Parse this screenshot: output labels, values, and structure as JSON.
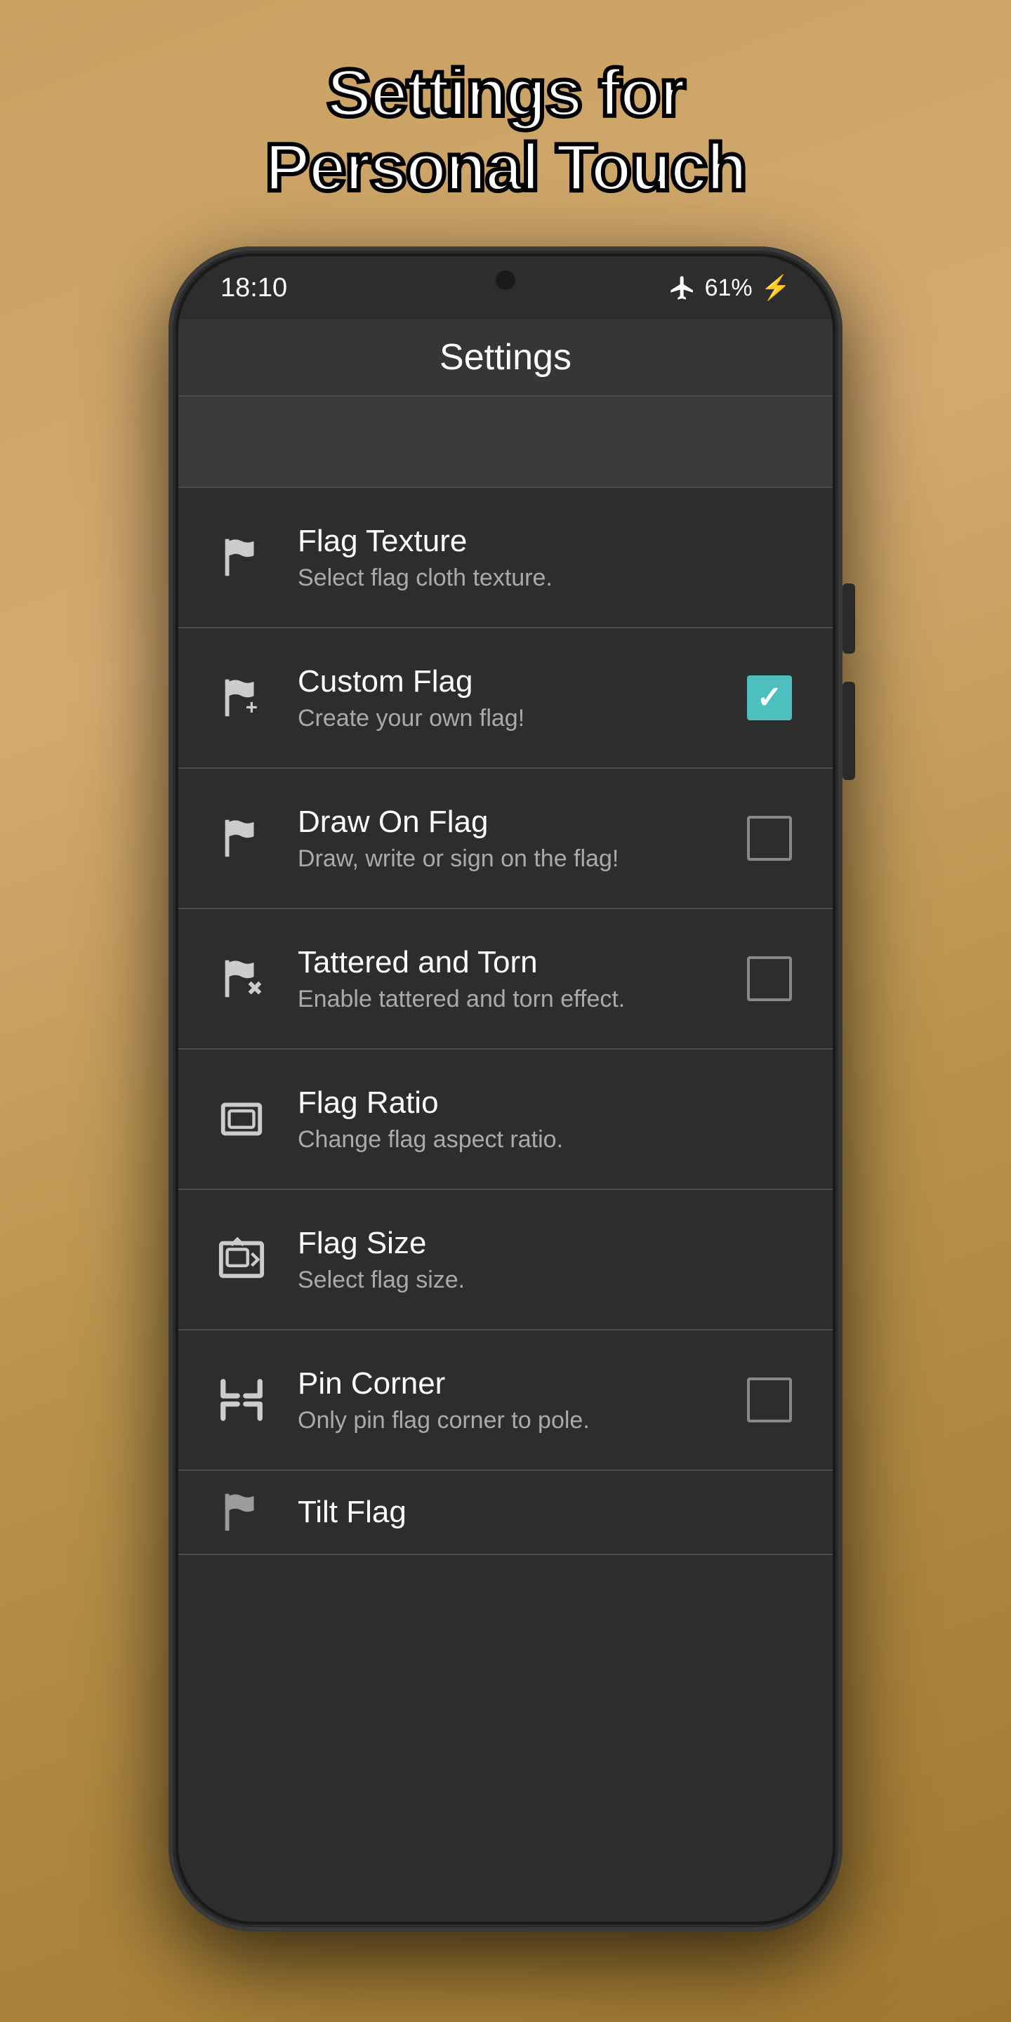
{
  "page": {
    "title_line1": "Settings for",
    "title_line2": "Personal Touch"
  },
  "status_bar": {
    "time": "18:10",
    "battery_text": "61%",
    "battery_icon": "⚡"
  },
  "app_header": {
    "title": "Settings"
  },
  "settings": {
    "items": [
      {
        "id": "flag-texture",
        "title": "Flag Texture",
        "subtitle": "Select flag cloth texture.",
        "has_checkbox": false,
        "checked": false,
        "icon": "flag-texture-icon"
      },
      {
        "id": "custom-flag",
        "title": "Custom Flag",
        "subtitle": "Create your own flag!",
        "has_checkbox": true,
        "checked": true,
        "icon": "custom-flag-icon"
      },
      {
        "id": "draw-on-flag",
        "title": "Draw On Flag",
        "subtitle": "Draw, write or sign on the flag!",
        "has_checkbox": true,
        "checked": false,
        "icon": "draw-flag-icon"
      },
      {
        "id": "tattered-torn",
        "title": "Tattered and Torn",
        "subtitle": "Enable tattered and torn effect.",
        "has_checkbox": true,
        "checked": false,
        "icon": "tattered-flag-icon"
      },
      {
        "id": "flag-ratio",
        "title": "Flag Ratio",
        "subtitle": "Change flag aspect ratio.",
        "has_checkbox": false,
        "checked": false,
        "icon": "flag-ratio-icon"
      },
      {
        "id": "flag-size",
        "title": "Flag Size",
        "subtitle": "Select flag size.",
        "has_checkbox": false,
        "checked": false,
        "icon": "flag-size-icon"
      },
      {
        "id": "pin-corner",
        "title": "Pin Corner",
        "subtitle": "Only pin flag corner to pole.",
        "has_checkbox": true,
        "checked": false,
        "icon": "pin-corner-icon"
      },
      {
        "id": "tilt-flag",
        "title": "Tilt Flag",
        "subtitle": "",
        "has_checkbox": false,
        "checked": false,
        "icon": "tilt-flag-icon",
        "partial": true
      }
    ]
  }
}
